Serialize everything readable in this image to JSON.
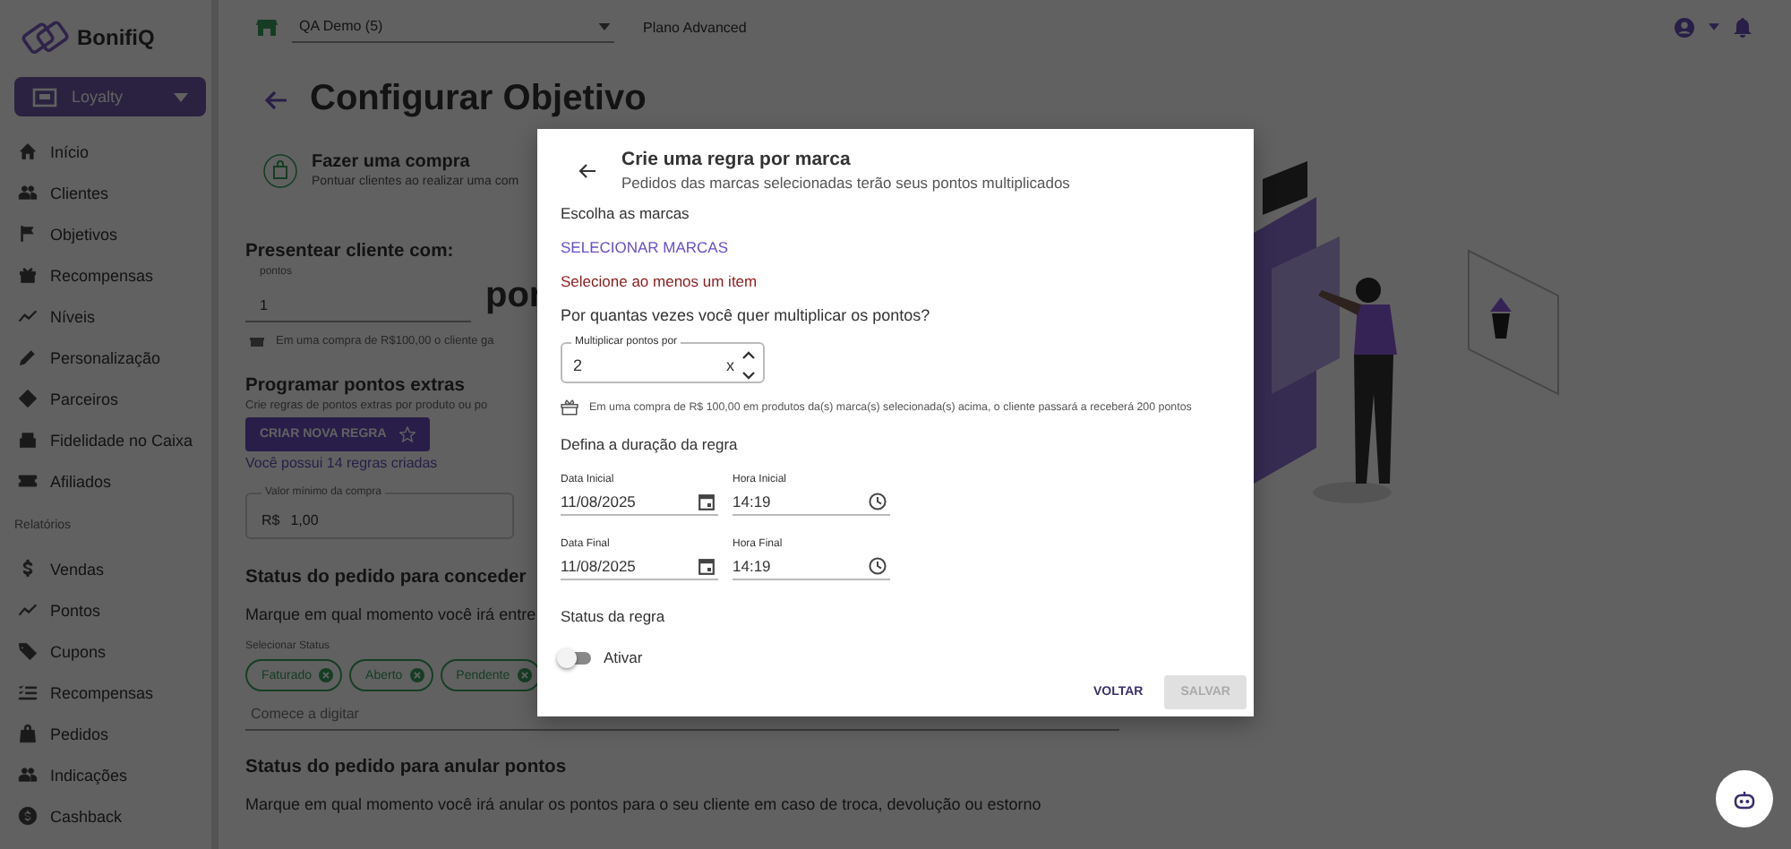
{
  "sidebar": {
    "logo": "BonifiQ",
    "module": "Loyalty",
    "items": [
      {
        "label": "Início"
      },
      {
        "label": "Clientes"
      },
      {
        "label": "Objetivos"
      },
      {
        "label": "Recompensas"
      },
      {
        "label": "Níveis"
      },
      {
        "label": "Personalização"
      },
      {
        "label": "Parceiros"
      },
      {
        "label": "Fidelidade no Caixa"
      },
      {
        "label": "Afiliados"
      }
    ],
    "section": "Relatórios",
    "report_items": [
      {
        "label": "Vendas"
      },
      {
        "label": "Pontos"
      },
      {
        "label": "Cupons"
      },
      {
        "label": "Recompensas"
      },
      {
        "label": "Pedidos"
      },
      {
        "label": "Indicações"
      },
      {
        "label": "Cashback"
      }
    ]
  },
  "topbar": {
    "store": "QA Demo (5)",
    "plan": "Plano Advanced"
  },
  "page": {
    "title": "Configurar Objetivo",
    "objective": {
      "title": "Fazer uma compra",
      "description": "Pontuar clientes ao realizar uma com"
    },
    "gift": {
      "title": "Presentear cliente com:",
      "field_label": "pontos",
      "value": "1",
      "big_text": "por",
      "hint": "Em uma compra de R$100,00 o cliente ga"
    },
    "extras": {
      "title": "Programar pontos extras",
      "description": "Crie regras de pontos extras por produto ou po",
      "button": "CRIAR NOVA REGRA",
      "count": "Você possui 14 regras criadas"
    },
    "min_value": {
      "label": "Valor mínimo da compra",
      "prefix": "R$",
      "value": "1,00"
    },
    "grant": {
      "title": "Status do pedido para conceder",
      "description": "Marque em qual momento você irá entre",
      "field_label": "Selecionar Status",
      "chips": [
        "Faturado",
        "Aberto",
        "Pendente"
      ],
      "placeholder": "Comece a digitar"
    },
    "void": {
      "title": "Status do pedido para anular pontos",
      "description": "Marque em qual momento você irá anular os pontos para o seu cliente em caso de troca, devolução ou estorno"
    }
  },
  "dialog": {
    "title": "Crie uma regra por marca",
    "subtitle": "Pedidos das marcas selecionadas terão seus pontos multiplicados",
    "brands_label": "Escolha as marcas",
    "brands_link": "SELECIONAR MARCAS",
    "error": "Selecione ao menos um item",
    "question": "Por quantas vezes você quer multiplicar os pontos?",
    "multiplier": {
      "label": "Multiplicar pontos por",
      "value": "2",
      "suffix": "x"
    },
    "hint": "Em uma compra de R$ 100,00 em produtos da(s) marca(s) selecionada(s) acima, o cliente passará a receberá 200 pontos",
    "duration_label": "Defina a duração da regra",
    "fields": [
      {
        "kind": "date",
        "label": "Data Inicial",
        "value": "11/08/2025"
      },
      {
        "kind": "time",
        "label": "Hora Inicial",
        "value": "14:19"
      },
      {
        "kind": "date",
        "label": "Data Final",
        "value": "11/08/2025"
      },
      {
        "kind": "time",
        "label": "Hora Final",
        "value": "14:19"
      }
    ],
    "status_label": "Status da regra",
    "toggle": {
      "label": "Ativar",
      "on": false
    },
    "buttons": [
      {
        "label": "VOLTAR",
        "disabled": false
      },
      {
        "label": "SALVAR",
        "disabled": true
      }
    ]
  }
}
